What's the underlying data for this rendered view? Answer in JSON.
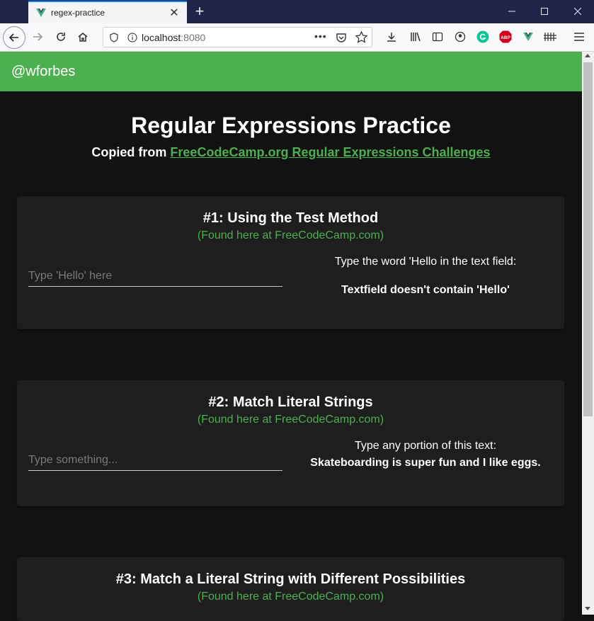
{
  "browser": {
    "tab_title": "regex-practice",
    "url_host": "localhost",
    "url_port": ":8080"
  },
  "app": {
    "handle": "@wforbes",
    "title": "Regular Expressions Practice",
    "subtitle_prefix": "Copied from ",
    "subtitle_link": "FreeCodeCamp.org Regular Expressions Challenges"
  },
  "cards": [
    {
      "title": "#1: Using the Test Method",
      "link": "(Found here at FreeCodeCamp.com)",
      "placeholder": "Type 'Hello' here",
      "prompt": "Type the word 'Hello in the text field:",
      "result": "Textfield doesn't contain 'Hello'"
    },
    {
      "title": "#2: Match Literal Strings",
      "link": "(Found here at FreeCodeCamp.com)",
      "placeholder": "Type something...",
      "prompt": "Type any portion of this text:",
      "result": "Skateboarding is super fun and I like eggs."
    },
    {
      "title": "#3: Match a Literal String with Different Possibilities",
      "link": "(Found here at FreeCodeCamp.com)"
    }
  ],
  "colors": {
    "accent": "#4caf50",
    "background": "#121212",
    "card": "#1e1e1e"
  }
}
